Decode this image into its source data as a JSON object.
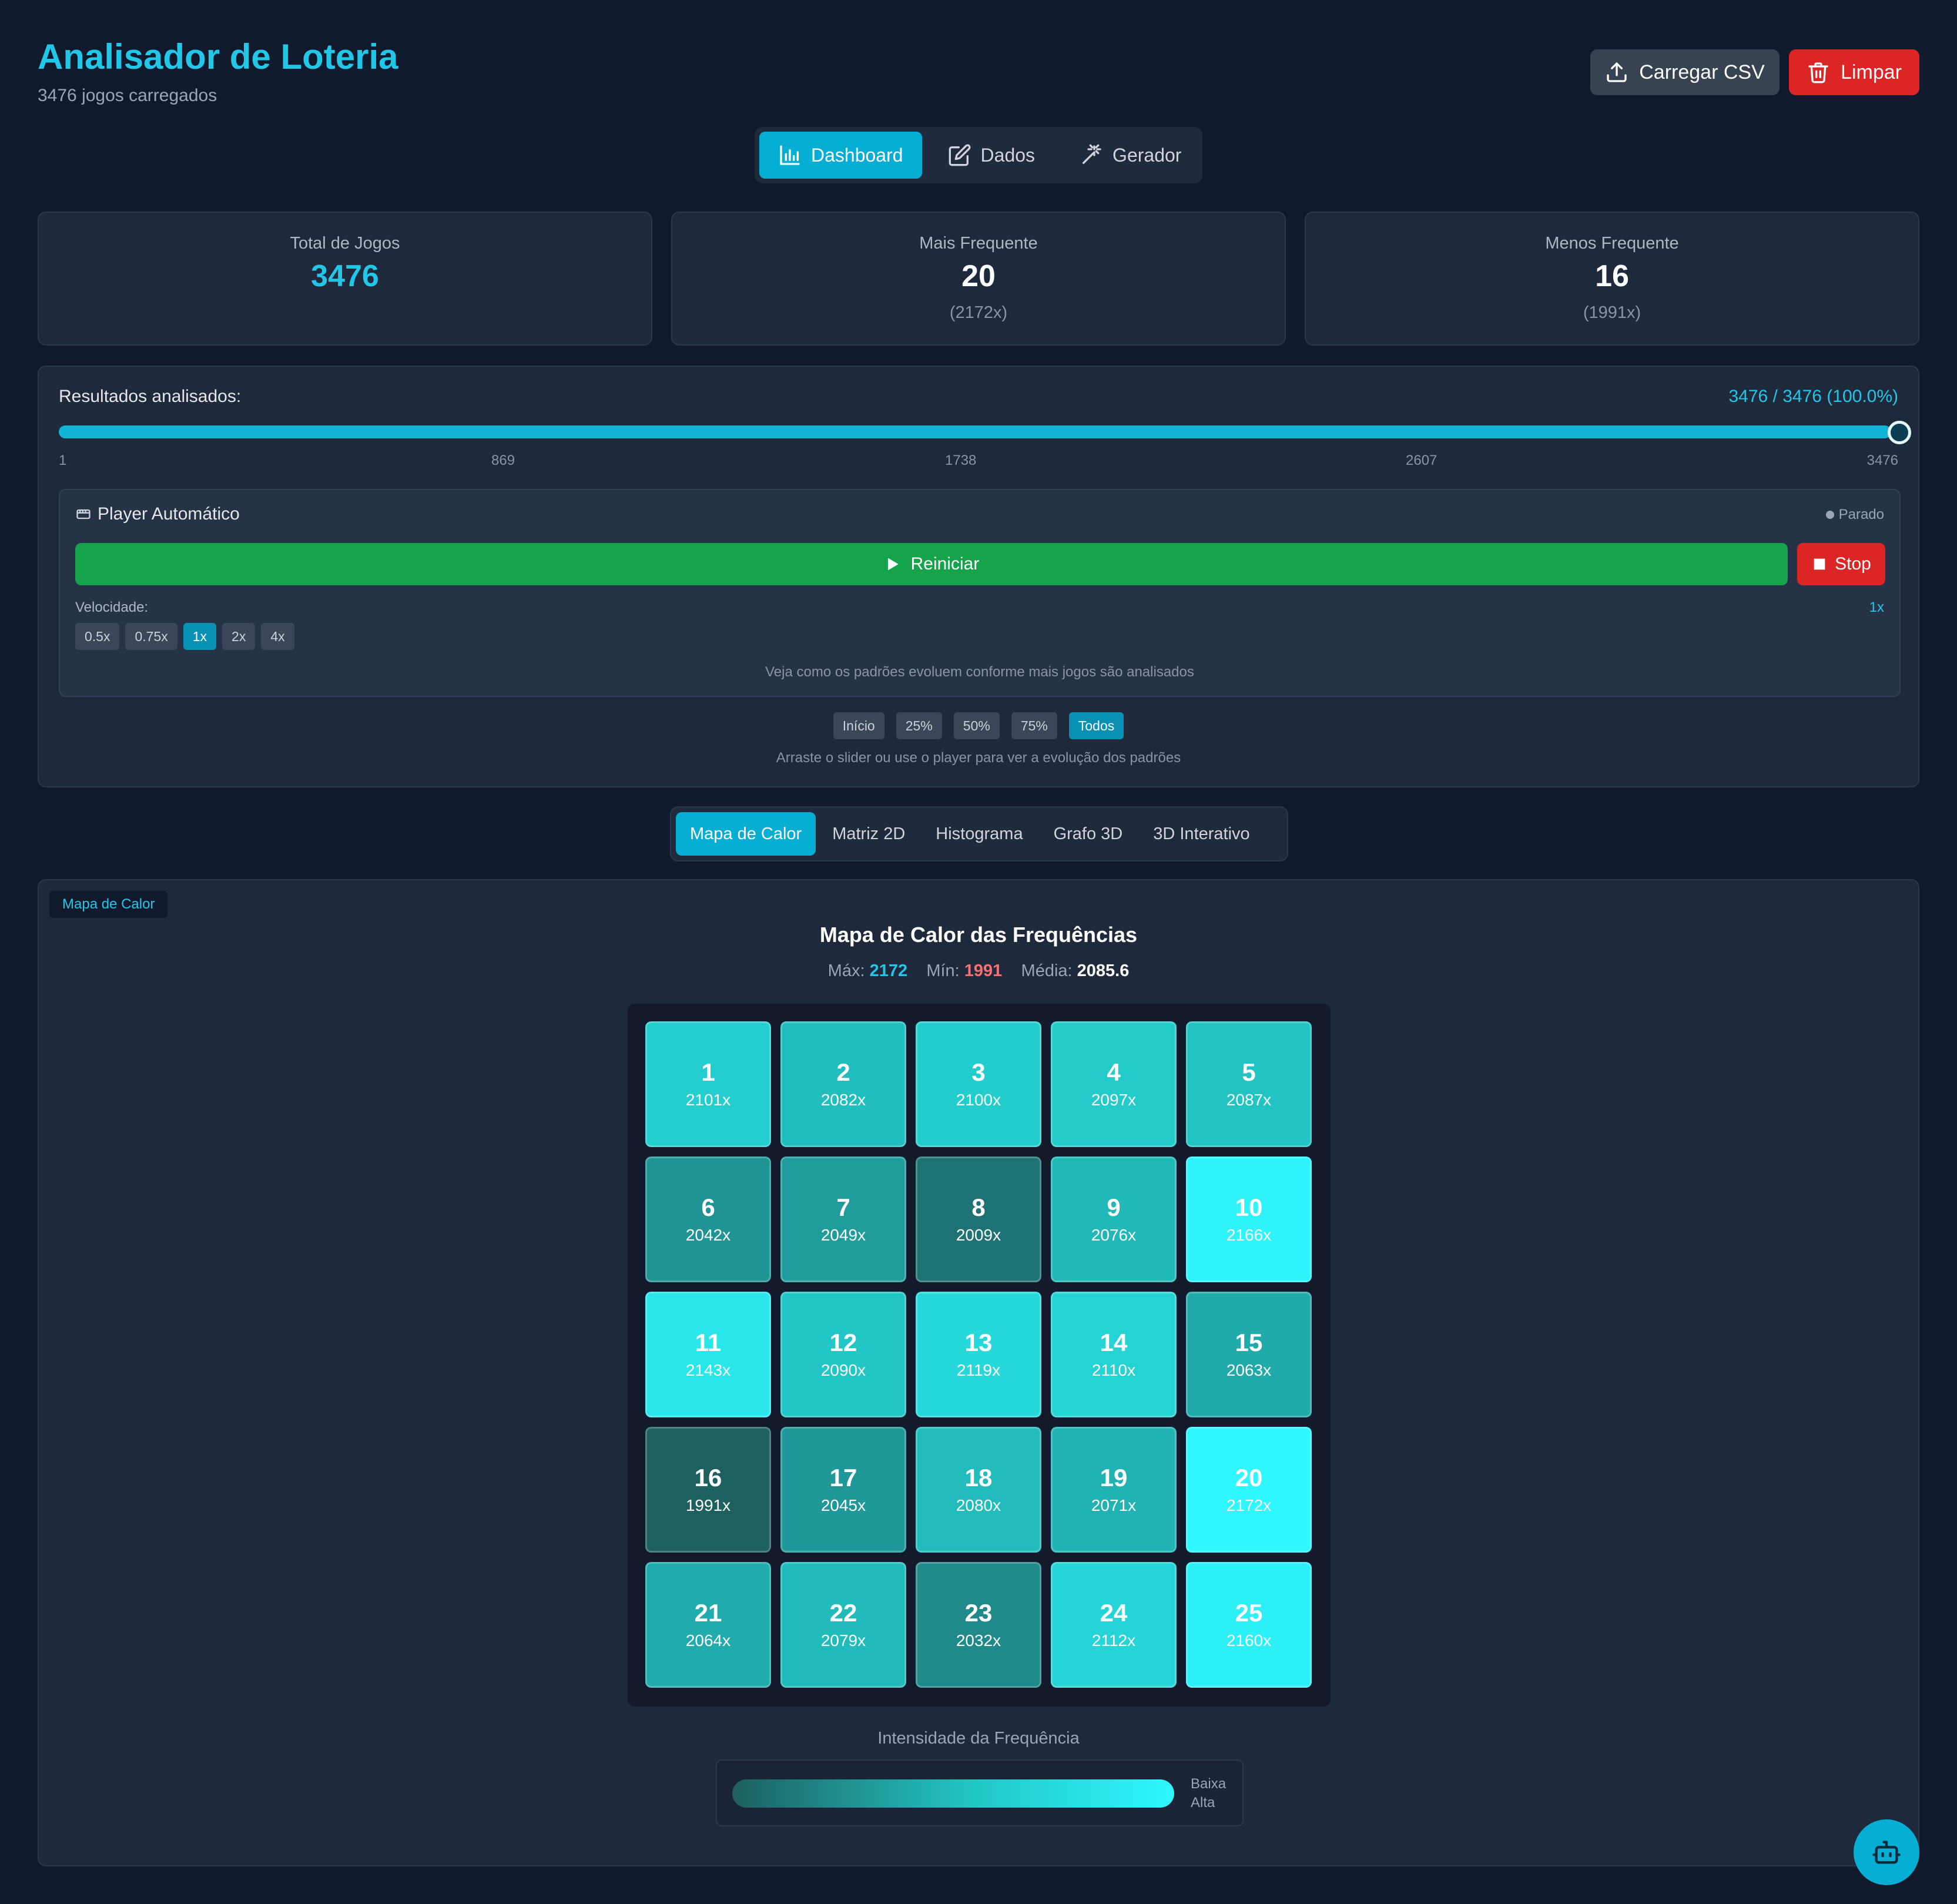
{
  "header": {
    "title": "Analisador de Loteria",
    "subtitle": "3476 jogos carregados",
    "upload_label": "Carregar CSV",
    "clear_label": "Limpar"
  },
  "nav": {
    "dashboard": "Dashboard",
    "data": "Dados",
    "generator": "Gerador"
  },
  "stats": {
    "total": {
      "label": "Total de Jogos",
      "value": "3476"
    },
    "most": {
      "label": "Mais Frequente",
      "value": "20",
      "count": "(2172x)"
    },
    "least": {
      "label": "Menos Frequente",
      "value": "16",
      "count": "(1991x)"
    }
  },
  "slider": {
    "label": "Resultados analisados:",
    "value_text": "3476 / 3476 (100.0%)",
    "progress": 1.0,
    "ticks": [
      "1",
      "869",
      "1738",
      "2607",
      "3476"
    ]
  },
  "player": {
    "title": "Player Automático",
    "status": "Parado",
    "restart_label": "Reiniciar",
    "stop_label": "Stop",
    "speed_label": "Velocidade:",
    "speed_current": "1x",
    "speeds": [
      "0.5x",
      "0.75x",
      "1x",
      "2x",
      "4x"
    ],
    "hint": "Veja como os padrões evoluem conforme mais jogos são analisados"
  },
  "presets": [
    "Início",
    "25%",
    "50%",
    "75%",
    "Todos"
  ],
  "panel_hint": "Arraste o slider ou use o player para ver a evolução dos padrões",
  "viz_tabs": [
    "Mapa de Calor",
    "Matriz 2D",
    "Histograma",
    "Grafo 3D",
    "3D Interativo"
  ],
  "heatmap": {
    "tag": "Mapa de Calor",
    "title": "Mapa de Calor das Frequências",
    "max_label": "Máx:",
    "max": "2172",
    "min_label": "Mín:",
    "min": "1991",
    "avg_label": "Média:",
    "avg": "2085.6",
    "legend_title": "Intensidade da Frequência",
    "legend_low": "Baixa",
    "legend_high": "Alta",
    "cells": [
      {
        "n": "1",
        "f": "2101x"
      },
      {
        "n": "2",
        "f": "2082x"
      },
      {
        "n": "3",
        "f": "2100x"
      },
      {
        "n": "4",
        "f": "2097x"
      },
      {
        "n": "5",
        "f": "2087x"
      },
      {
        "n": "6",
        "f": "2042x"
      },
      {
        "n": "7",
        "f": "2049x"
      },
      {
        "n": "8",
        "f": "2009x"
      },
      {
        "n": "9",
        "f": "2076x"
      },
      {
        "n": "10",
        "f": "2166x"
      },
      {
        "n": "11",
        "f": "2143x"
      },
      {
        "n": "12",
        "f": "2090x"
      },
      {
        "n": "13",
        "f": "2119x"
      },
      {
        "n": "14",
        "f": "2110x"
      },
      {
        "n": "15",
        "f": "2063x"
      },
      {
        "n": "16",
        "f": "1991x"
      },
      {
        "n": "17",
        "f": "2045x"
      },
      {
        "n": "18",
        "f": "2080x"
      },
      {
        "n": "19",
        "f": "2071x"
      },
      {
        "n": "20",
        "f": "2172x"
      },
      {
        "n": "21",
        "f": "2064x"
      },
      {
        "n": "22",
        "f": "2079x"
      },
      {
        "n": "23",
        "f": "2032x"
      },
      {
        "n": "24",
        "f": "2112x"
      },
      {
        "n": "25",
        "f": "2160x"
      }
    ]
  },
  "colors": {
    "accent": "#22c7e8",
    "danger": "#dc2626",
    "success": "#16a34a",
    "heat_low": "#1e5f60",
    "heat_high": "#2ff7ff"
  }
}
